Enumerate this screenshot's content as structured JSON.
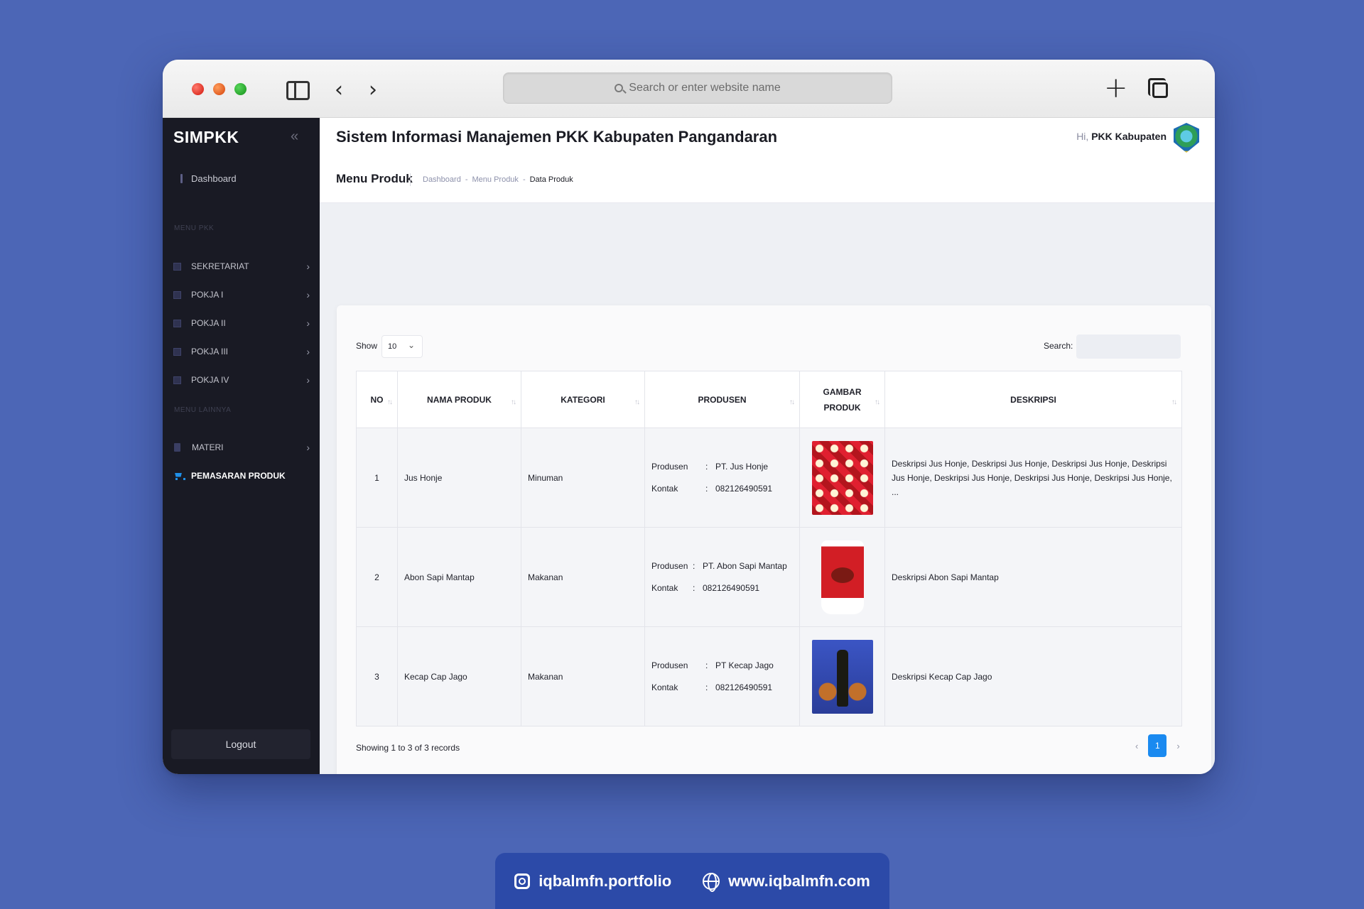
{
  "browser": {
    "url_placeholder": "Search or enter website name"
  },
  "sidebar": {
    "brand": "SIMPKK",
    "dashboard": "Dashboard",
    "section_pkk": "MENU PKK",
    "pkk_items": [
      {
        "label": "SEKRETARIAT"
      },
      {
        "label": "POKJA I"
      },
      {
        "label": "POKJA II"
      },
      {
        "label": "POKJA III"
      },
      {
        "label": "POKJA IV"
      }
    ],
    "section_other": "MENU LAINNYA",
    "other_items": [
      {
        "label": "MATERI"
      },
      {
        "label": "PEMASARAN PRODUK"
      }
    ],
    "logout": "Logout",
    "colors": {
      "bg": "#191a24",
      "active_icon": "#1f8fe8"
    }
  },
  "header": {
    "title": "Sistem Informasi Manajemen PKK Kabupaten Pangandaran",
    "greeting_hi": "Hi,",
    "greeting_user": "PKK Kabupaten"
  },
  "page": {
    "title": "Menu Produk",
    "breadcrumb": [
      "Dashboard",
      "-",
      "Menu Produk",
      "-",
      "Data Produk"
    ]
  },
  "table": {
    "show_label": "Show",
    "show_value": "10",
    "search_label": "Search:",
    "columns": [
      "NO",
      "NAMA PRODUK",
      "KATEGORI",
      "PRODUSEN",
      "GAMBAR PRODUK",
      "DESKRIPSI"
    ],
    "produsen_key": "Produsen",
    "kontak_key": "Kontak",
    "colon": ":",
    "rows": [
      {
        "no": "1",
        "nama": "Jus Honje",
        "kategori": "Minuman",
        "produsen": "PT. Jus Honje",
        "kontak": "082126490591",
        "image": "juice-product-image",
        "deskripsi": "Deskripsi Jus Honje, Deskripsi Jus Honje, Deskripsi Jus Honje, Deskripsi Jus Honje, Deskripsi Jus Honje, Deskripsi Jus Honje, Deskripsi Jus Honje, ..."
      },
      {
        "no": "2",
        "nama": "Abon Sapi Mantap",
        "kategori": "Makanan",
        "produsen": "PT. Abon Sapi Mantap",
        "kontak": "082126490591",
        "image": "abon-product-image",
        "deskripsi": "Deskripsi Abon Sapi Mantap"
      },
      {
        "no": "3",
        "nama": "Kecap Cap Jago",
        "kategori": "Makanan",
        "produsen": "PT Kecap Jago",
        "kontak": "082126490591",
        "image": "kecap-product-image",
        "deskripsi": "Deskripsi Kecap Cap Jago"
      }
    ],
    "showing": "Showing 1 to 3 of 3 records",
    "pagination": {
      "prev": "‹",
      "current": "1",
      "next": "›"
    }
  },
  "footer": {
    "instagram": "iqbalmfn.portfolio",
    "website": "www.iqbalmfn.com"
  },
  "colors": {
    "page_bg": "#4c66b6",
    "accent": "#1a8af0"
  }
}
